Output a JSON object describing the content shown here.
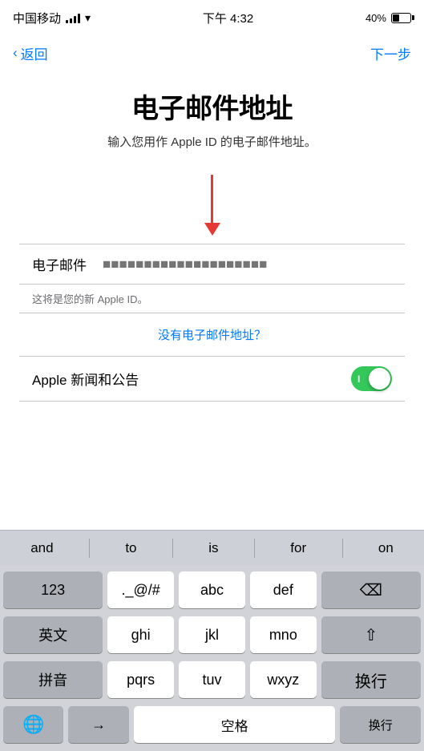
{
  "statusBar": {
    "carrier": "中国移动",
    "time": "下午 4:32",
    "battery": "40%"
  },
  "navBar": {
    "backLabel": "返回",
    "nextLabel": "下一步"
  },
  "page": {
    "title": "电子邮件地址",
    "subtitle": "输入您用作 Apple ID 的电子邮件地址。"
  },
  "form": {
    "emailLabel": "电子邮件",
    "emailPlaceholder": "■■■■■■■■■■■■■■■■■■■■",
    "hint": "这将是您的新 Apple ID。",
    "noEmailLink": "没有电子邮件地址？"
  },
  "toggle": {
    "label": "Apple 新闻和公告",
    "toggleOnText": "I"
  },
  "autocomplete": {
    "words": [
      "and",
      "to",
      "is",
      "for",
      "on"
    ]
  },
  "keyboard": {
    "row1": [
      "123",
      "._@/#",
      "abc",
      "def",
      "⌫"
    ],
    "row2": [
      "英文",
      "ghi",
      "jkl",
      "mno",
      "⇧"
    ],
    "row3": [
      "拼音",
      "pqrs",
      "tuv",
      "wxyz",
      "换行"
    ],
    "bottomLeft1": "🌐",
    "bottomLeft2": "→",
    "space": "空格",
    "enter": "换行"
  }
}
